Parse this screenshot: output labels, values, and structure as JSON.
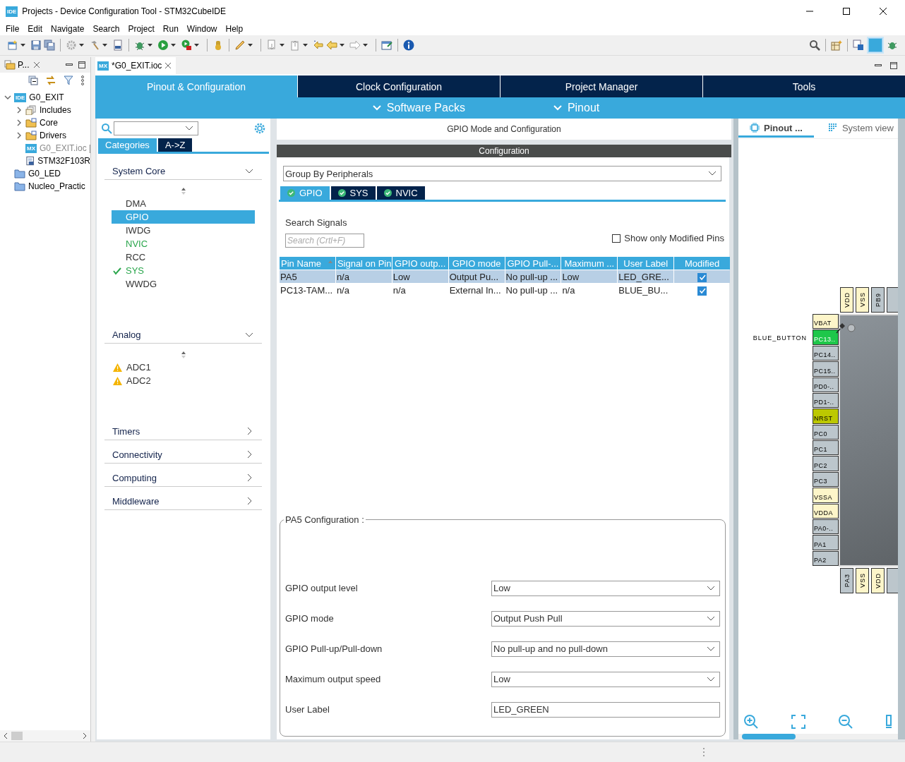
{
  "window": {
    "app_badge": "IDE",
    "title": "Projects - Device Configuration Tool - STM32CubeIDE"
  },
  "menu": [
    "File",
    "Edit",
    "Navigate",
    "Search",
    "Project",
    "Run",
    "Window",
    "Help"
  ],
  "explorer": {
    "tab": "P...",
    "tree": [
      {
        "label": "G0_EXIT",
        "kind": "project",
        "badge": "IDE",
        "expanded": true,
        "children": [
          {
            "label": "Includes",
            "kind": "includes",
            "expanded": false
          },
          {
            "label": "Core",
            "kind": "source-folder",
            "expanded": false
          },
          {
            "label": "Drivers",
            "kind": "source-folder",
            "expanded": false
          },
          {
            "label": "G0_EXIT.ioc [",
            "kind": "ioc",
            "badge": "MX",
            "dimmed": true
          },
          {
            "label": "STM32F103R",
            "kind": "file"
          }
        ]
      },
      {
        "label": "G0_LED",
        "kind": "folder"
      },
      {
        "label": "Nucleo_Practic",
        "kind": "folder"
      }
    ]
  },
  "editor_tab": {
    "badge": "MX",
    "label": "*G0_EXIT.ioc"
  },
  "nav": {
    "tabs": [
      {
        "label": "Pinout & Configuration",
        "selected": true
      },
      {
        "label": "Clock Configuration",
        "selected": false
      },
      {
        "label": "Project Manager",
        "selected": false
      },
      {
        "label": "Tools",
        "selected": false
      }
    ],
    "menus": [
      "Software Packs",
      "Pinout"
    ]
  },
  "categories": {
    "tabs": [
      {
        "label": "Categories",
        "selected": true
      },
      {
        "label": "A->Z",
        "selected": false
      }
    ],
    "groups": [
      {
        "label": "System Core",
        "expanded": true,
        "items": [
          {
            "label": "DMA",
            "selected": false,
            "kind": "plain"
          },
          {
            "label": "GPIO",
            "selected": true,
            "kind": "plain"
          },
          {
            "label": "IWDG",
            "selected": false,
            "kind": "plain"
          },
          {
            "label": "NVIC",
            "selected": false,
            "kind": "configured"
          },
          {
            "label": "RCC",
            "selected": false,
            "kind": "plain"
          },
          {
            "label": "SYS",
            "selected": false,
            "kind": "ok"
          },
          {
            "label": "WWDG",
            "selected": false,
            "kind": "plain"
          }
        ]
      },
      {
        "label": "Analog",
        "expanded": true,
        "items": [
          {
            "label": "ADC1",
            "selected": false,
            "kind": "warning"
          },
          {
            "label": "ADC2",
            "selected": false,
            "kind": "warning"
          }
        ]
      },
      {
        "label": "Timers",
        "expanded": false
      },
      {
        "label": "Connectivity",
        "expanded": false
      },
      {
        "label": "Computing",
        "expanded": false
      },
      {
        "label": "Middleware",
        "expanded": false
      }
    ]
  },
  "mode": {
    "title": "GPIO Mode and Configuration",
    "config_bar": "Configuration",
    "group_select": "Group By Peripherals",
    "tabs": [
      {
        "label": "GPIO",
        "selected": true
      },
      {
        "label": "SYS",
        "selected": false
      },
      {
        "label": "NVIC",
        "selected": false
      }
    ],
    "search_label": "Search Signals",
    "search": {
      "placeholder": "Search (Crtl+F)"
    },
    "show_modified": {
      "label": "Show only Modified Pins",
      "checked": false
    },
    "table": {
      "columns": [
        "Pin Name",
        "Signal on Pin",
        "GPIO outp...",
        "GPIO mode",
        "GPIO Pull-...",
        "Maximum ...",
        "User Label",
        "Modified"
      ],
      "rows": [
        {
          "selected": true,
          "cells": [
            "PA5",
            "n/a",
            "Low",
            "Output Pu...",
            "No pull-up ...",
            "Low",
            "LED_GRE..."
          ],
          "modified": true
        },
        {
          "selected": false,
          "cells": [
            "PC13-TAM...",
            "n/a",
            "n/a",
            "External In...",
            "No pull-up ...",
            "n/a",
            "BLUE_BU..."
          ],
          "modified": true
        }
      ]
    },
    "detail": {
      "title": "PA5 Configuration :",
      "fields": [
        {
          "label": "GPIO output level",
          "kind": "select",
          "value": "Low"
        },
        {
          "label": "GPIO mode",
          "kind": "select",
          "value": "Output Push Pull"
        },
        {
          "label": "GPIO Pull-up/Pull-down",
          "kind": "select",
          "value": "No pull-up and no pull-down"
        },
        {
          "label": "Maximum output speed",
          "kind": "select",
          "value": "Low"
        },
        {
          "label": "User Label",
          "kind": "text",
          "value": "LED_GREEN"
        }
      ]
    }
  },
  "pinout": {
    "tabs": [
      {
        "label": "Pinout ...",
        "selected": true
      },
      {
        "label": "System view",
        "selected": false
      }
    ],
    "top_pins": [
      {
        "label": "VDD",
        "kind": "power"
      },
      {
        "label": "VSS",
        "kind": "power"
      },
      {
        "label": "PB9",
        "kind": "io"
      }
    ],
    "left_pins": [
      {
        "label": "VBAT",
        "kind": "power"
      },
      {
        "label": "PC13..",
        "kind": "configured",
        "signal": "BLUE_BUTTON"
      },
      {
        "label": "PC14..",
        "kind": "io"
      },
      {
        "label": "PC15..",
        "kind": "io"
      },
      {
        "label": "PD0-..",
        "kind": "io"
      },
      {
        "label": "PD1-..",
        "kind": "io"
      },
      {
        "label": "NRST",
        "kind": "reset"
      },
      {
        "label": "PC0",
        "kind": "io"
      },
      {
        "label": "PC1",
        "kind": "io"
      },
      {
        "label": "PC2",
        "kind": "io"
      },
      {
        "label": "PC3",
        "kind": "io"
      },
      {
        "label": "VSSA",
        "kind": "power"
      },
      {
        "label": "VDDA",
        "kind": "power"
      },
      {
        "label": "PA0-..",
        "kind": "io"
      },
      {
        "label": "PA1",
        "kind": "io"
      },
      {
        "label": "PA2",
        "kind": "io"
      }
    ],
    "bottom_pins": [
      {
        "label": "PA3",
        "kind": "io"
      },
      {
        "label": "VSS",
        "kind": "power"
      },
      {
        "label": "VDD",
        "kind": "power"
      }
    ]
  }
}
